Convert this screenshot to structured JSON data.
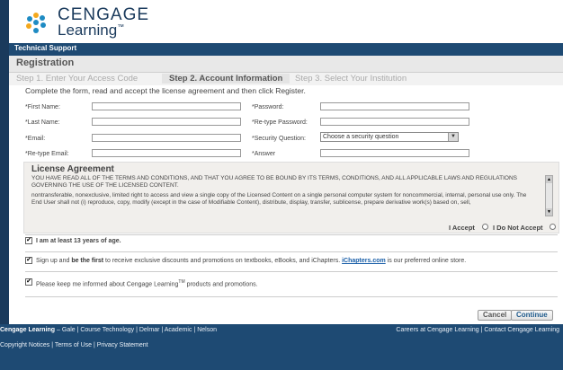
{
  "brand": {
    "name": "CENGAGE",
    "sub": "Learning",
    "tm": "™"
  },
  "topbar": {
    "label": "Technical Support"
  },
  "header": {
    "title": "Registration"
  },
  "steps": [
    {
      "label": "Step 1. Enter Your Access Code"
    },
    {
      "label": "Step 2. Account Information"
    },
    {
      "label": "Step 3. Select Your Institution"
    }
  ],
  "instructions": "Complete the form, read and accept the license agreement and then click Register.",
  "form": {
    "first_name": "*First Name:",
    "last_name": "*Last Name:",
    "email": "*Email:",
    "retype_email": "*Re-type Email:",
    "password": "*Password:",
    "retype_password": "*Re-type Password:",
    "security_question": "*Security Question:",
    "security_value": "Choose a security question",
    "answer": "*Answer"
  },
  "license": {
    "title": "License Agreement",
    "text1": "YOU HAVE READ ALL OF THE TERMS AND CONDITIONS, AND THAT YOU AGREE TO BE BOUND BY ITS TERMS, CONDITIONS, AND ALL APPLICABLE LAWS AND REGULATIONS GOVERNING THE USE OF THE LICENSED CONTENT.",
    "text2": "nontransferable, nonexclusive, limited right to access and view a single copy of the Licensed Content on a single personal computer system for noncommercial, internal, personal use only. The End User shall not (i) reproduce, copy, modify (except in the case of Modifiable Content), distribute, display, transfer, sublicense, prepare derivative work(s) based on, sell,",
    "accept": "I Accept",
    "decline": "I Do Not Accept"
  },
  "checks": {
    "age": "I am at least 13 years of age.",
    "promo_pre": "Sign up and ",
    "promo_bold": "be the first",
    "promo_mid": " to receive exclusive discounts and promotions on textbooks, eBooks, and iChapters. ",
    "promo_link": "iChapters.com",
    "promo_post": " is our preferred online store.",
    "keep_pre": "Please keep me informed about Cengage Learning",
    "keep_tm": "TM",
    "keep_post": " products and promotions."
  },
  "buttons": {
    "cancel": "Cancel",
    "continue": "Continue"
  },
  "footer": {
    "brand": "Cengage Learning",
    "links_left": "– Gale  |  Course Technology  |  Delmar  |  Academic  |  Nelson",
    "links_right": "Careers at Cengage Learning  |  Contact Cengage Learning",
    "links_bottom": "Copyright Notices  |  Terms of Use  |  Privacy Statement"
  }
}
